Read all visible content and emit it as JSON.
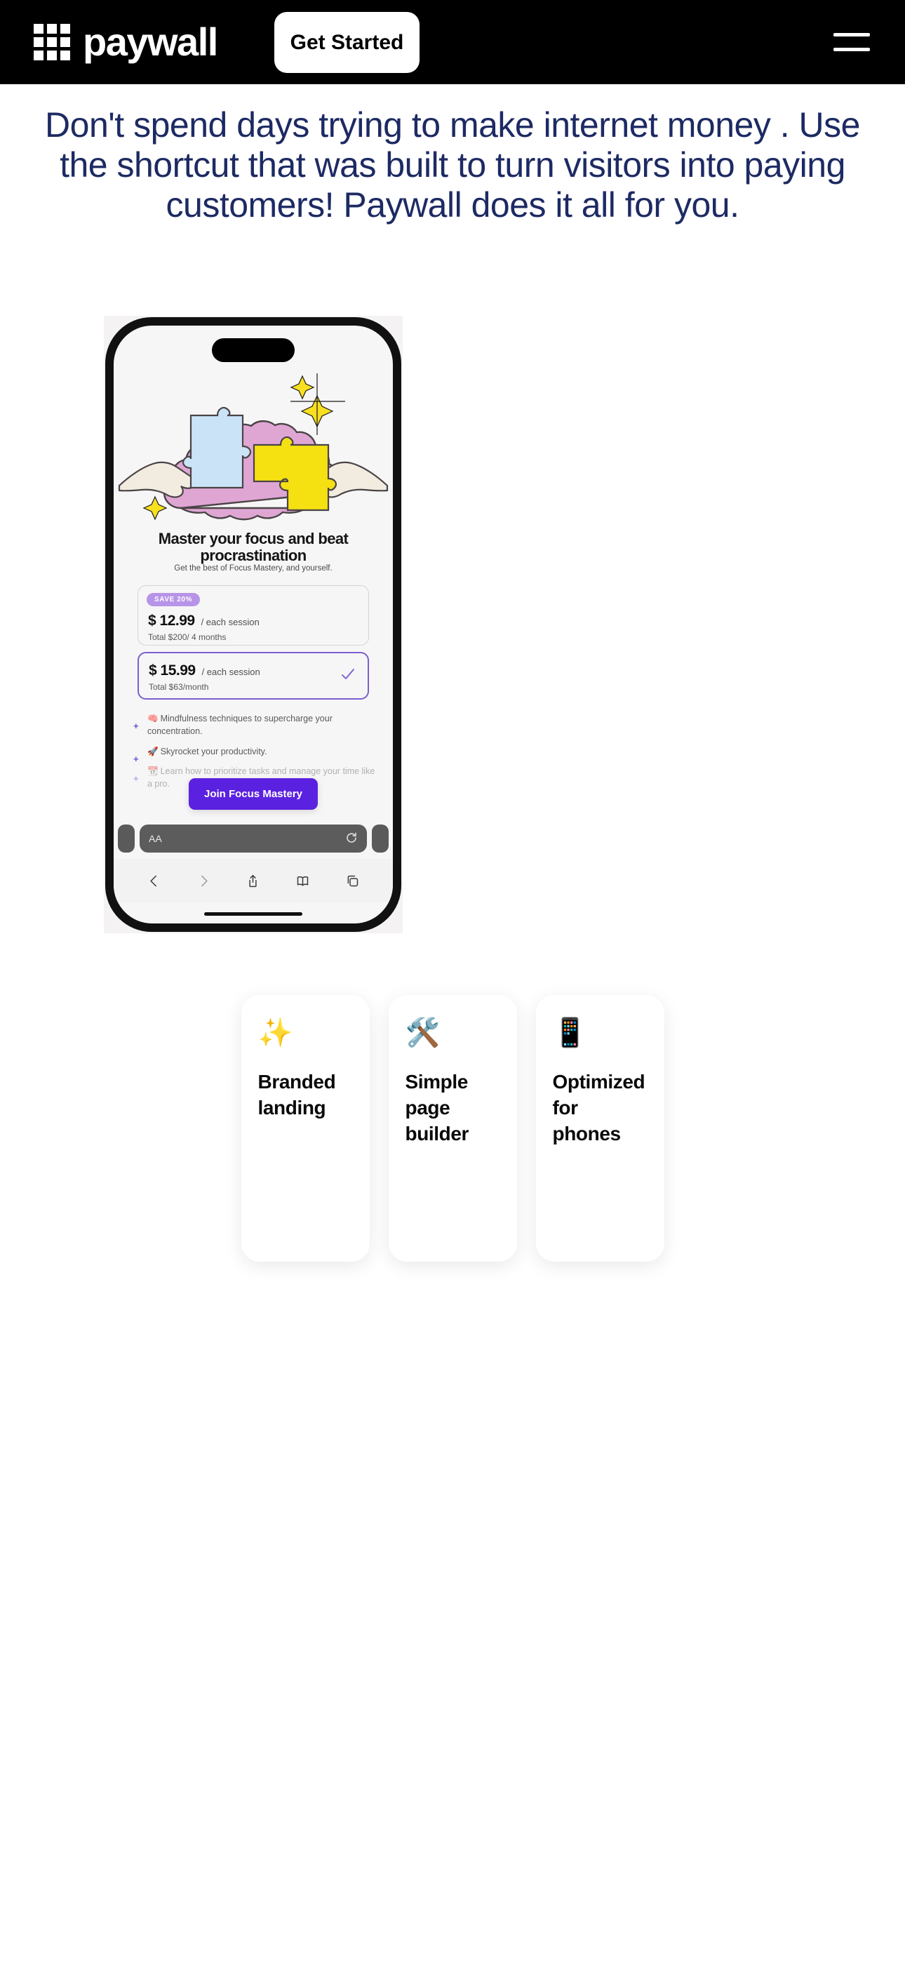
{
  "nav": {
    "brand": "paywall",
    "logo_icon": "grid-3x3-icon",
    "cta_label": "Get Started",
    "menu_icon": "hamburger-menu-icon",
    "background": "#000000"
  },
  "hero": {
    "headline": "Don't spend days trying to make internet money . Use the shortcut that was built to turn visitors into paying customers! Paywall does it all for you.",
    "headline_color": "#1d2a63"
  },
  "phone": {
    "paywall": {
      "title": "Master your focus and beat procrastination",
      "subtitle": "Get the best of Focus Mastery, and yourself.",
      "plans": [
        {
          "badge": "SAVE  20%",
          "amount": "$ 12.99",
          "unit": "/ each session",
          "total": "Total $200/ 4 months",
          "selected": false
        },
        {
          "badge": null,
          "amount": "$ 15.99",
          "unit": "/ each session",
          "total": "Total $63/month",
          "selected": true
        }
      ],
      "features": [
        {
          "emoji": "🧠",
          "text": "Mindfulness techniques to supercharge your concentration."
        },
        {
          "emoji": "🚀",
          "text": "Skyrocket your productivity."
        },
        {
          "emoji": "📆",
          "text": "Learn how to prioritize tasks and manage your time like a pro."
        }
      ],
      "cta_label": "Join Focus Mastery",
      "cta_color": "#5b21e0",
      "badge_color": "#b794e8",
      "selected_border_color": "#7b5ed0"
    },
    "safari": {
      "aa_label": "AA",
      "reload_icon": "reload-icon",
      "back_icon": "chevron-left-icon",
      "forward_icon": "chevron-right-icon",
      "share_icon": "share-icon",
      "bookmarks_icon": "book-icon",
      "tabs_icon": "tabs-icon"
    }
  },
  "feature_cards": [
    {
      "emoji": "✨",
      "icon_name": "sparkles-icon",
      "title": "Branded landing"
    },
    {
      "emoji": "🛠️",
      "icon_name": "tools-icon",
      "title": "Simple page builder"
    },
    {
      "emoji": "📱",
      "icon_name": "mobile-phone-icon",
      "title": "Optimized for phones"
    }
  ]
}
